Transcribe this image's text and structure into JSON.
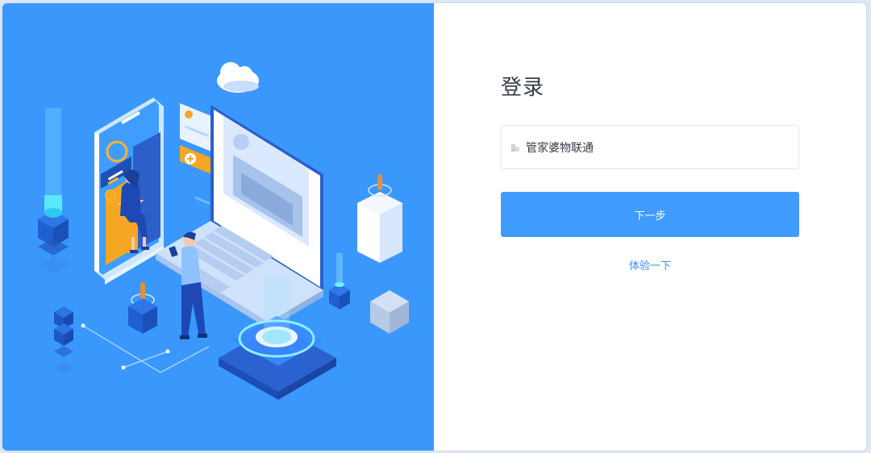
{
  "login": {
    "title": "登录",
    "company_field": {
      "value": "管家婆物联通",
      "icon": "building-icon"
    },
    "next_button_label": "下一步",
    "trial_link_label": "体验一下"
  },
  "theme": {
    "illustration_background": "#3a98fd",
    "primary_button": "#3f9bfc",
    "link": "#3a8ef0",
    "title_text": "#333a44"
  }
}
